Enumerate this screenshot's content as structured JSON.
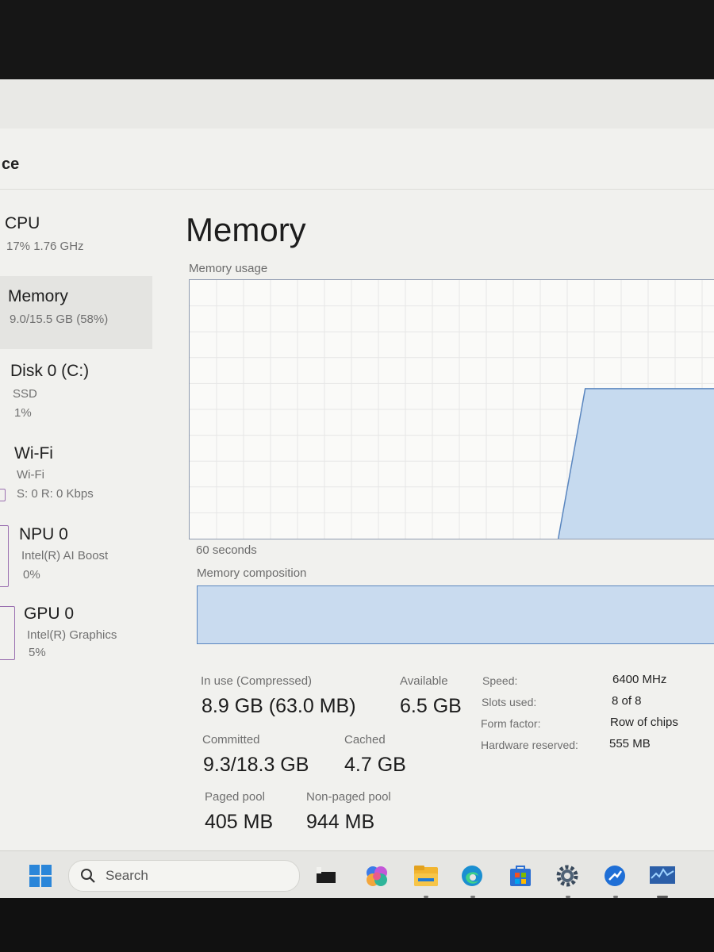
{
  "window": {
    "title_fragment": "ce"
  },
  "sidebar": {
    "items": [
      {
        "title": "CPU",
        "line1": "17%  1.76 GHz"
      },
      {
        "title": "Memory",
        "line1": "9.0/15.5 GB (58%)"
      },
      {
        "title": "Disk 0 (C:)",
        "line1": "SSD",
        "line2": "1%"
      },
      {
        "title": "Wi-Fi",
        "line1": "Wi-Fi",
        "line2": "S: 0  R: 0 Kbps"
      },
      {
        "title": "NPU 0",
        "line1": "Intel(R) AI Boost",
        "line2": "0%"
      },
      {
        "title": "GPU 0",
        "line1": "Intel(R) Graphics",
        "line2": "5%"
      }
    ]
  },
  "main": {
    "title": "Memory",
    "usage_label": "Memory usage",
    "time_label": "60 seconds",
    "composition_label": "Memory composition",
    "stats": {
      "in_use_label": "In use (Compressed)",
      "in_use_value": "8.9 GB (63.0 MB)",
      "available_label": "Available",
      "available_value": "6.5 GB",
      "committed_label": "Committed",
      "committed_value": "9.3/18.3 GB",
      "cached_label": "Cached",
      "cached_value": "4.7 GB",
      "paged_label": "Paged pool",
      "paged_value": "405 MB",
      "nonpaged_label": "Non-paged pool",
      "nonpaged_value": "944 MB"
    },
    "specs": {
      "speed_label": "Speed:",
      "speed_value": "6400 MHz",
      "slots_label": "Slots used:",
      "slots_value": "8 of 8",
      "form_label": "Form factor:",
      "form_value": "Row of chips",
      "reserved_label": "Hardware reserved:",
      "reserved_value": "555 MB"
    }
  },
  "taskbar": {
    "search_placeholder": "Search",
    "icons": [
      "windows-start-icon",
      "task-view-icon",
      "copilot-icon",
      "file-explorer-icon",
      "edge-icon",
      "microsoft-store-icon",
      "settings-icon",
      "app-icon",
      "task-manager-icon"
    ]
  },
  "chart_data": {
    "type": "area",
    "title": "Memory usage",
    "xlabel": "60 seconds",
    "ylabel": "",
    "x_direction": "seconds ago (60 at left, 0 at right)",
    "x": [
      60,
      19,
      16,
      0
    ],
    "values_percent": [
      null,
      0,
      58,
      58
    ],
    "ylim": [
      0,
      100
    ],
    "grid": true,
    "colors": {
      "fill": "#c6daef",
      "line": "#5a86bf"
    }
  }
}
